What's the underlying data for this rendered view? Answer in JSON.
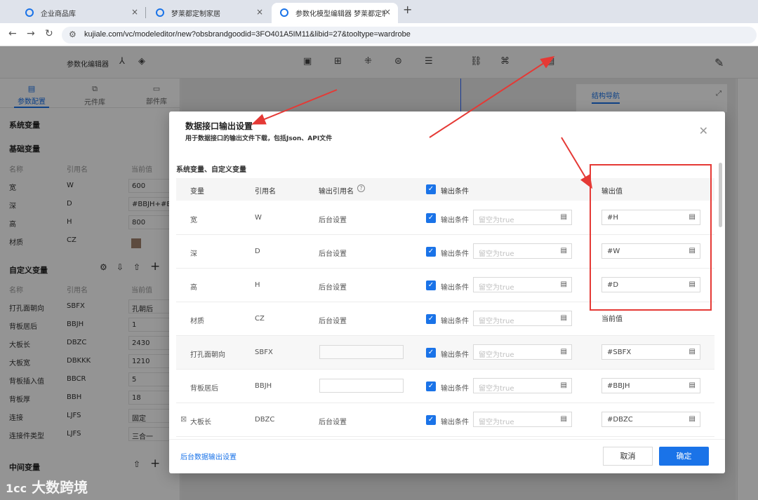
{
  "browser": {
    "tabs": [
      {
        "label": "企业商品库",
        "close": "×"
      },
      {
        "label": "梦莱都定制家居",
        "close": "×"
      },
      {
        "label": "参数化模型编辑器 梦莱都定制家",
        "close": "×"
      }
    ],
    "new_tab": "+",
    "url": "kujiale.com/vc/modeleditor/new?obsbrandgoodid=3FO401A5IM11&libid=27&tooltype=wardrobe"
  },
  "app": {
    "title": "参数化编辑器",
    "left_tabs": [
      "参数配置",
      "元件库",
      "部件库"
    ],
    "system_vars_title": "系统变量",
    "basic_vars_title": "基础变量",
    "var_headers": [
      "名称",
      "引用名",
      "当前值"
    ],
    "basic_vars": [
      {
        "name": "宽",
        "ref": "W",
        "value": "600"
      },
      {
        "name": "深",
        "ref": "D",
        "value": "#BBJH+#BBH"
      },
      {
        "name": "高",
        "ref": "H",
        "value": "800"
      },
      {
        "name": "材质",
        "ref": "CZ",
        "value": ""
      }
    ],
    "custom_vars_title": "自定义变量",
    "custom_vars": [
      {
        "name": "打孔面朝向",
        "ref": "SBFX",
        "value": "孔朝后"
      },
      {
        "name": "背板居后",
        "ref": "BBJH",
        "value": "1"
      },
      {
        "name": "大板长",
        "ref": "DBZC",
        "value": "2430"
      },
      {
        "name": "大板宽",
        "ref": "DBKKK",
        "value": "1210"
      },
      {
        "name": "背板插入值",
        "ref": "BBCR",
        "value": "5"
      },
      {
        "name": "背板厚",
        "ref": "BBH",
        "value": "18"
      },
      {
        "name": "连接",
        "ref": "LJFS",
        "value": "固定"
      },
      {
        "name": "连接件类型",
        "ref": "LJFS",
        "value": "三合一"
      }
    ],
    "middle_vars_title": "中间变量",
    "struct_nav": "结构导航"
  },
  "modal": {
    "title": "数据接口输出设置",
    "subtitle": "用于数据接口的输出文件下载，包括Json、API文件",
    "section": "系统变量、自定义变量",
    "headers": {
      "var": "变量",
      "ref": "引用名",
      "out_ref": "输出引用名",
      "cond": "输出条件",
      "out_val": "输出值"
    },
    "rows": [
      {
        "var": "宽",
        "ref": "W",
        "out_ref": "后台设置",
        "cond_label": "输出条件",
        "cond_ph": "留空为true",
        "out_val": "#H",
        "out_type": "input"
      },
      {
        "var": "深",
        "ref": "D",
        "out_ref": "后台设置",
        "cond_label": "输出条件",
        "cond_ph": "留空为true",
        "out_val": "#W",
        "out_type": "input"
      },
      {
        "var": "高",
        "ref": "H",
        "out_ref": "后台设置",
        "cond_label": "输出条件",
        "cond_ph": "留空为true",
        "out_val": "#D",
        "out_type": "input"
      },
      {
        "var": "材质",
        "ref": "CZ",
        "out_ref": "后台设置",
        "cond_label": "输出条件",
        "cond_ph": "留空为true",
        "out_val": "当前值",
        "out_type": "text"
      },
      {
        "var": "打孔面朝向",
        "ref": "SBFX",
        "out_ref": "",
        "cond_label": "输出条件",
        "cond_ph": "留空为true",
        "out_val": "#SBFX",
        "out_type": "input"
      },
      {
        "var": "背板居后",
        "ref": "BBJH",
        "out_ref": "",
        "cond_label": "输出条件",
        "cond_ph": "留空为true",
        "out_val": "#BBJH",
        "out_type": "input"
      },
      {
        "var": "大板长",
        "ref": "DBZC",
        "out_ref": "后台设置",
        "cond_label": "输出条件",
        "cond_ph": "留空为true",
        "out_val": "#DBZC",
        "out_type": "input"
      }
    ],
    "footer_link": "后台数据输出设置",
    "cancel": "取消",
    "ok": "确定"
  },
  "watermark": "大数跨境",
  "colors": {
    "accent": "#1a73e8",
    "annotation": "#e53935"
  }
}
